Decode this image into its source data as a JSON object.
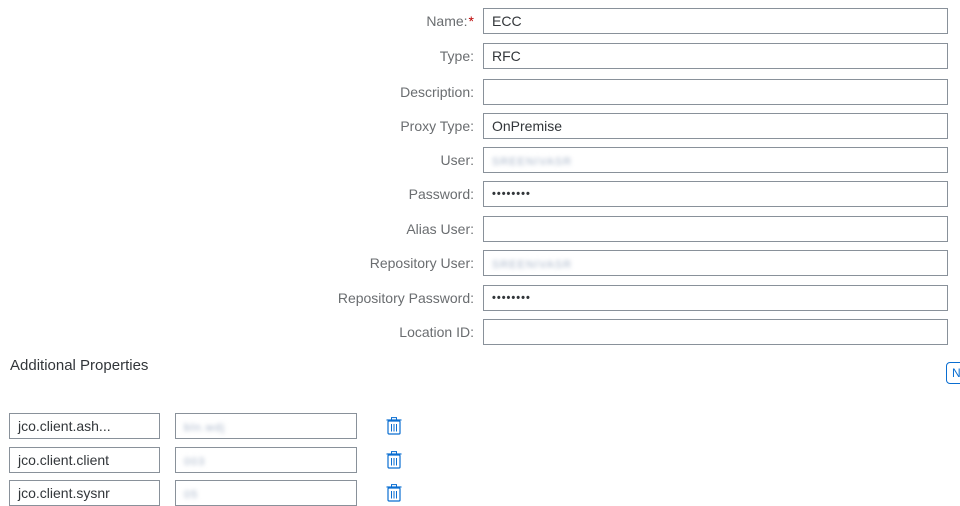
{
  "form": {
    "fields": [
      {
        "label": "Name:",
        "required": true,
        "value": "ECC"
      },
      {
        "label": "Type:",
        "value": "RFC"
      },
      {
        "label": "Description:",
        "value": ""
      },
      {
        "label": "Proxy Type:",
        "value": "OnPremise"
      },
      {
        "label": "User:",
        "value": "SREENIVASR",
        "blurred": true
      },
      {
        "label": "Password:",
        "value": "••••••••"
      },
      {
        "label": "Alias User:",
        "value": ""
      },
      {
        "label": "Repository User:",
        "value": "SREENIVASR",
        "blurred": true
      },
      {
        "label": "Repository Password:",
        "value": "••••••••"
      },
      {
        "label": "Location ID:",
        "value": ""
      }
    ],
    "required_marker": "*"
  },
  "additional": {
    "title": "Additional Properties",
    "new_button_label": "N",
    "properties": [
      {
        "key": "jco.client.ash...",
        "value": "bln.wdj"
      },
      {
        "key": "jco.client.client",
        "value": "003"
      },
      {
        "key": "jco.client.sysnr",
        "value": "05"
      }
    ],
    "delete_icon": "trash-icon"
  },
  "colors": {
    "accent": "#0a6ed1",
    "required": "#bb0000",
    "label": "#6a6d70",
    "border": "#89919a"
  }
}
